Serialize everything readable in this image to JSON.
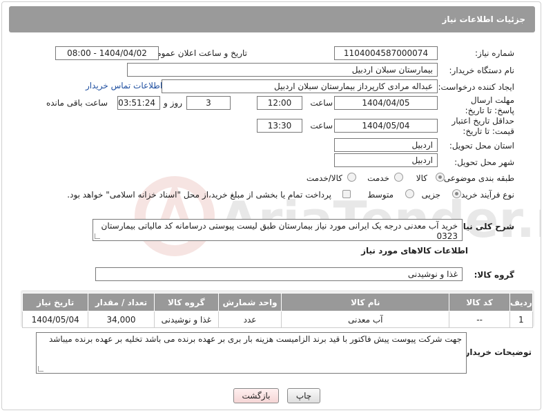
{
  "header": {
    "title": "جزئیات اطلاعات نیاز"
  },
  "form": {
    "need_number": {
      "label": "شماره نیاز:",
      "value": "1104004587000074"
    },
    "announce_datetime": {
      "label": "تاریخ و ساعت اعلان عمومی:",
      "value": "1404/04/02 - 08:00"
    },
    "buyer_org": {
      "label": "نام دستگاه خریدار:",
      "value": "بیمارستان سبلان اردبیل"
    },
    "requester": {
      "label": "ایجاد کننده درخواست:",
      "value": "عبداله مرادی کارپرداز بیمارستان سبلان اردبیل",
      "contact_link": "اطلاعات تماس خریدار"
    },
    "reply_deadline": {
      "label": "مهلت ارسال پاسخ: تا تاریخ:",
      "date": "1404/04/05",
      "time_label": "ساعت",
      "time": "12:00",
      "days": "3",
      "days_label": "روز و",
      "remaining": "03:51:24",
      "remaining_label": "ساعت باقی مانده"
    },
    "price_validity": {
      "label": "حداقل تاریخ اعتبار قیمت: تا تاریخ:",
      "date": "1404/05/04",
      "time_label": "ساعت",
      "time": "13:30"
    },
    "delivery_province": {
      "label": "استان محل تحویل:",
      "value": "اردبیل"
    },
    "delivery_city": {
      "label": "شهر محل تحویل:",
      "value": "اردبیل"
    },
    "category": {
      "label": "طبقه بندی موضوعی:",
      "options": [
        "کالا",
        "خدمت",
        "کالا/خدمت"
      ],
      "selected": "کالا"
    },
    "process_type": {
      "label": "نوع فرآیند خرید :",
      "options": [
        "جزیی",
        "متوسط"
      ],
      "selected": "جزیی",
      "payment_note": "پرداخت تمام یا بخشی از مبلغ خرید،از محل \"اسناد خزانه اسلامی\" خواهد بود."
    },
    "description": {
      "label": "شرح کلی نیاز:",
      "value": "خرید آب معدنی درجه یک ایرانی مورد نیاز بیمارستان طبق لیست پیوستی درسامانه کد مالیاتی بیمارستان 0323"
    }
  },
  "goods": {
    "section_title": "اطلاعات کالاهای مورد نیاز",
    "group_label": "گروه کالا:",
    "group_value": "غذا و نوشیدنی",
    "columns": [
      "ردیف",
      "کد کالا",
      "نام کالا",
      "واحد شمارش",
      "گروه کالا",
      "تعداد / مقدار",
      "تاریخ نیاز"
    ],
    "rows": [
      [
        "1",
        "--",
        "آب معدنی",
        "عدد",
        "غذا و نوشیدنی",
        "34,000",
        "1404/05/04"
      ]
    ]
  },
  "buyer_notes": {
    "label": "توضیحات خریدار:",
    "value": "جهت شرکت پیوست پیش فاکتور با قید برند الزامیست هزینه بار بری بر عهده برنده می باشد تخلیه بر عهده برنده میباشد"
  },
  "buttons": {
    "print": "چاپ",
    "back": "بازگشت"
  },
  "watermark": {
    "text": "AriaTender.net"
  },
  "colors": {
    "header_bg": "#9a9a9a",
    "link": "#1f4fa0",
    "back_button": "#f5d5d5"
  }
}
